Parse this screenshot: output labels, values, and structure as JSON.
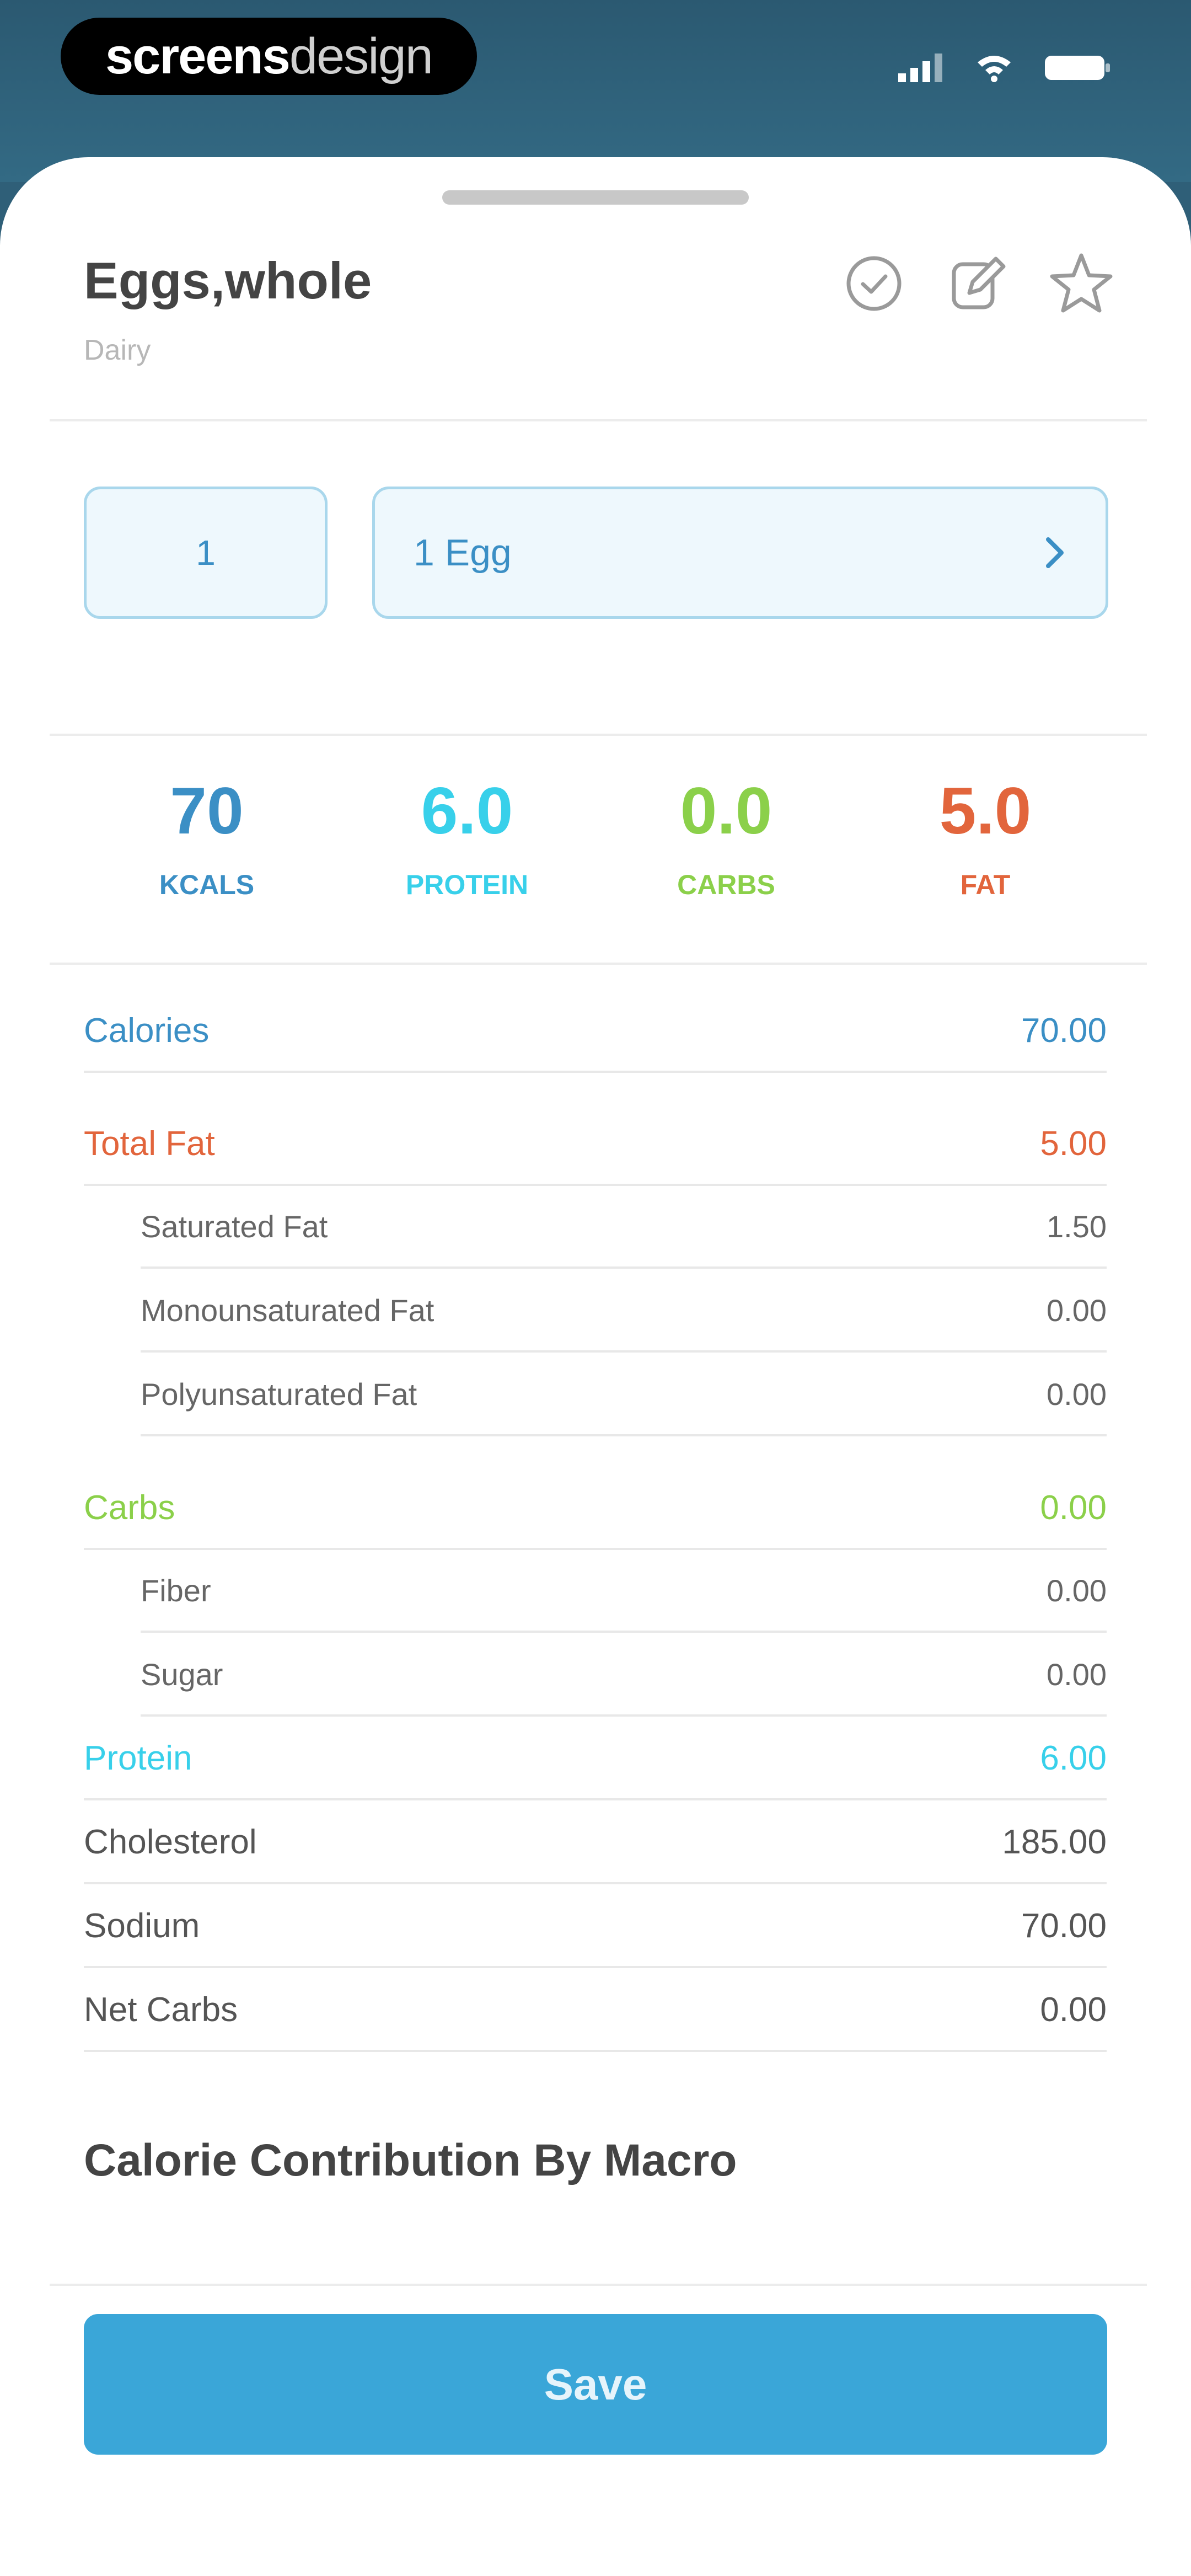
{
  "status_bar": {
    "brand_a": "screens",
    "brand_b": "design",
    "signal_icon": "signal-icon",
    "wifi_icon": "wifi-icon",
    "battery_icon": "battery-icon"
  },
  "header": {
    "title": "Eggs,whole",
    "category": "Dairy",
    "icons": [
      "check-circle-icon",
      "edit-icon",
      "star-icon"
    ]
  },
  "serving": {
    "quantity": "1",
    "unit": "1 Egg",
    "unit_icon": "chevron-right-icon"
  },
  "macros": [
    {
      "value": "70",
      "label": "KCALS",
      "color": "#3b8fc5"
    },
    {
      "value": "6.0",
      "label": "PROTEIN",
      "color": "#38d0ea"
    },
    {
      "value": "0.0",
      "label": "CARBS",
      "color": "#8bd04a"
    },
    {
      "value": "5.0",
      "label": "FAT",
      "color": "#e2653c"
    }
  ],
  "nutrients": [
    {
      "label": "Calories",
      "value": "70.00",
      "type": "main",
      "color": "#3b8fc5"
    },
    {
      "label": "Total Fat",
      "value": "5.00",
      "type": "main",
      "color": "#e2653c"
    },
    {
      "label": "Saturated Fat",
      "value": "1.50",
      "type": "sub"
    },
    {
      "label": "Monounsaturated Fat",
      "value": "0.00",
      "type": "sub"
    },
    {
      "label": "Polyunsaturated Fat",
      "value": "0.00",
      "type": "sub"
    },
    {
      "label": "Carbs",
      "value": "0.00",
      "type": "main",
      "color": "#8bd04a"
    },
    {
      "label": "Fiber",
      "value": "0.00",
      "type": "sub"
    },
    {
      "label": "Sugar",
      "value": "0.00",
      "type": "sub"
    },
    {
      "label": "Protein",
      "value": "6.00",
      "type": "main",
      "color": "#38d0ea"
    },
    {
      "label": "Cholesterol",
      "value": "185.00",
      "type": "plain"
    },
    {
      "label": "Sodium",
      "value": "70.00",
      "type": "plain"
    },
    {
      "label": "Net Carbs",
      "value": "0.00",
      "type": "plain"
    }
  ],
  "section": {
    "title": "Calorie Contribution By Macro"
  },
  "actions": {
    "save_label": "Save",
    "save_color": "#3aa6d8"
  }
}
